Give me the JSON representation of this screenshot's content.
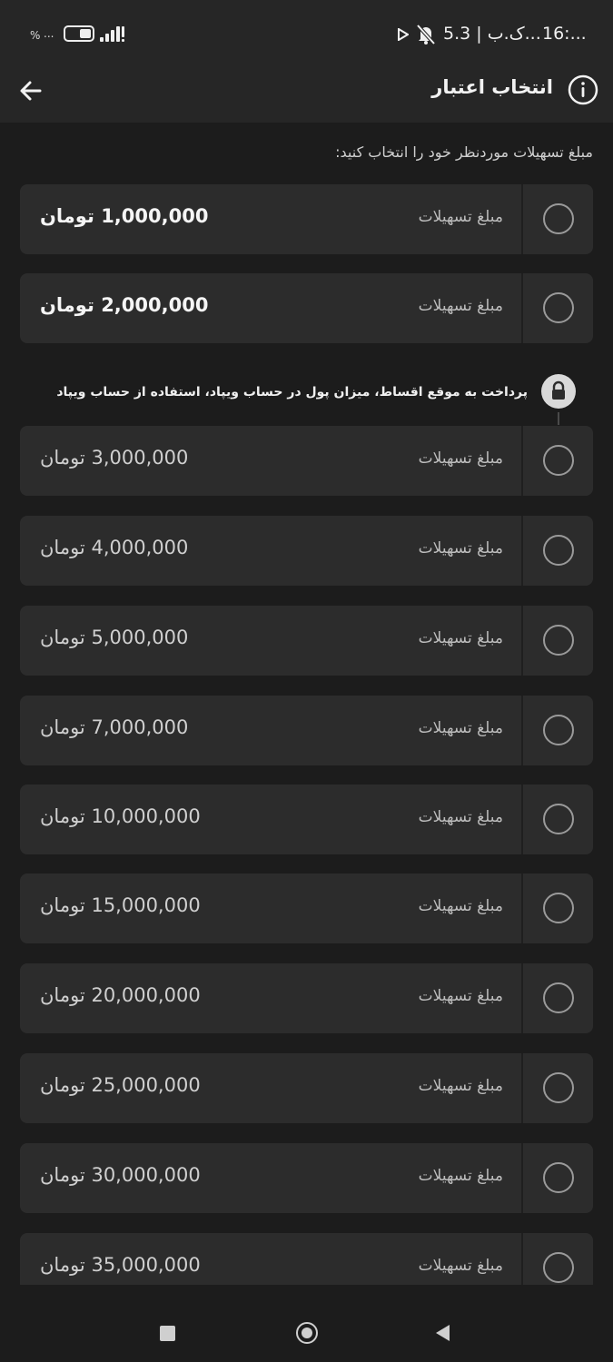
{
  "status_bar": {
    "time": "16:...",
    "speed": "5.3 | ک.ب...",
    "battery_dots": "...",
    "battery_percent": "%",
    "icons": [
      "mute-icon",
      "play-icon",
      "signal-icon",
      "battery-icon"
    ]
  },
  "header": {
    "title": "انتخاب اعتبار",
    "back_icon": "arrow-left-icon",
    "info_icon": "info-icon"
  },
  "instruction": "مبلغ تسهیلات موردنظر خود را انتخاب کنید:",
  "lock_notice": {
    "text": "پرداخت به موقع اقساط، میزان پول در حساب ویپاد، استفاده از حساب ویپاد",
    "icon": "lock-icon"
  },
  "currency": "تومان",
  "options": [
    {
      "label": "مبلغ تسهیلات",
      "amount": "1,000,000",
      "locked": false
    },
    {
      "label": "مبلغ تسهیلات",
      "amount": "2,000,000",
      "locked": false
    },
    {
      "label": "مبلغ تسهیلات",
      "amount": "3,000,000",
      "locked": true
    },
    {
      "label": "مبلغ تسهیلات",
      "amount": "4,000,000",
      "locked": true
    },
    {
      "label": "مبلغ تسهیلات",
      "amount": "5,000,000",
      "locked": true
    },
    {
      "label": "مبلغ تسهیلات",
      "amount": "7,000,000",
      "locked": true
    },
    {
      "label": "مبلغ تسهیلات",
      "amount": "10,000,000",
      "locked": true
    },
    {
      "label": "مبلغ تسهیلات",
      "amount": "15,000,000",
      "locked": true
    },
    {
      "label": "مبلغ تسهیلات",
      "amount": "20,000,000",
      "locked": true
    },
    {
      "label": "مبلغ تسهیلات",
      "amount": "25,000,000",
      "locked": true
    },
    {
      "label": "مبلغ تسهیلات",
      "amount": "30,000,000",
      "locked": true
    },
    {
      "label": "مبلغ تسهیلات",
      "amount": "35,000,000",
      "locked": true
    }
  ],
  "nav_bar": {
    "icons": [
      "recent-apps-icon",
      "home-icon",
      "back-triangle-icon"
    ]
  },
  "colors": {
    "background": "#1c1c1c",
    "bar": "#262626",
    "card": "#2c2c2c",
    "text": "#e8e8e8",
    "muted": "#bdbdbd"
  }
}
